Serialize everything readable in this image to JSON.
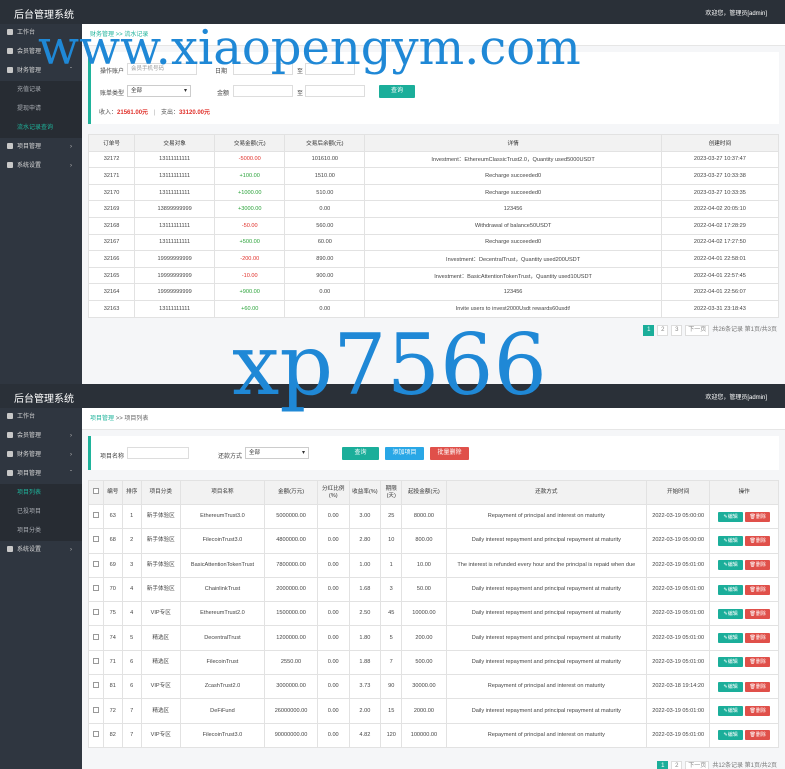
{
  "brand": "后台管理系统",
  "panel1": {
    "user": "欢迎您，管理员[admin]",
    "menu": [
      {
        "label": "工作台",
        "sub": []
      },
      {
        "label": "会员管理",
        "caret": "›",
        "sub": []
      },
      {
        "label": "财务管理",
        "caret": "ˇ",
        "sub": [
          "充值记录",
          "提现申请",
          "流水记录查询"
        ]
      },
      {
        "label": "项目管理",
        "caret": "›",
        "sub": []
      },
      {
        "label": "系统设置",
        "caret": "›",
        "sub": []
      }
    ],
    "crumb": "财务管理 >> 流水记录",
    "filter": {
      "account_label": "操作账户",
      "account_placeholder": "会员手机号码",
      "date_label": "日期",
      "date_to": "至",
      "type_label": "账单类型",
      "type_value": "全部",
      "amount_label": "金额",
      "amount_to": "至",
      "search_btn": "查询"
    },
    "summary": {
      "income_label": "收入：",
      "income": "21561.00元",
      "sep": "|",
      "expense_label": "支出：",
      "expense": "33120.00元"
    },
    "columns": [
      "订单号",
      "交易对象",
      "交易金额(元)",
      "交易后余额(元)",
      "详情",
      "创建时间"
    ],
    "rows": [
      [
        "32172",
        "13111111111",
        "-5000.00",
        "101610.00",
        "Investment：EthereumClassicTrust2.0，Quantity used5000USDT",
        "2023-03-27 10:37:47"
      ],
      [
        "32171",
        "13111111111",
        "+100.00",
        "1510.00",
        "Recharge succeeded0",
        "2023-03-27 10:33:38"
      ],
      [
        "32170",
        "13111111111",
        "+1000.00",
        "510.00",
        "Recharge succeeded0",
        "2023-03-27 10:33:35"
      ],
      [
        "32169",
        "13899999999",
        "+3000.00",
        "0.00",
        "123456",
        "2022-04-02 20:05:10"
      ],
      [
        "32168",
        "13111111111",
        "-50.00",
        "560.00",
        "Withdrawal of balance50USDT",
        "2022-04-02 17:28:29"
      ],
      [
        "32167",
        "13111111111",
        "+500.00",
        "60.00",
        "Recharge succeeded0",
        "2022-04-02 17:27:50"
      ],
      [
        "32166",
        "19999999999",
        "-200.00",
        "890.00",
        "Investment：DecentralTrust，Quantity used200USDT",
        "2022-04-01 22:58:01"
      ],
      [
        "32165",
        "19999999999",
        "-10.00",
        "900.00",
        "Investment：BasicAttentionTokenTrust，Quantity used10USDT",
        "2022-04-01 22:57:45"
      ],
      [
        "32164",
        "19999999999",
        "+900.00",
        "0.00",
        "123456",
        "2022-04-01 22:56:07"
      ],
      [
        "32163",
        "13111111111",
        "+60.00",
        "0.00",
        "Invite users to invest2000Usdt rewards60usdt!",
        "2022-03-31 23:18:43"
      ]
    ],
    "pager": {
      "pages": [
        "1",
        "2",
        "3"
      ],
      "next": "下一页",
      "info": "共26条记录 第1页/共3页"
    }
  },
  "panel2": {
    "user": "欢迎您，管理员[admin]",
    "menu": [
      {
        "label": "工作台",
        "sub": []
      },
      {
        "label": "会员管理",
        "caret": "›",
        "sub": []
      },
      {
        "label": "财务管理",
        "caret": "›",
        "sub": []
      },
      {
        "label": "项目管理",
        "caret": "ˇ",
        "sub": [
          "项目列表",
          "已投项目",
          "项目分类"
        ]
      },
      {
        "label": "系统设置",
        "caret": "›",
        "sub": []
      }
    ],
    "crumb_link": "项目管理",
    "crumb_rest": ">>  项目列表",
    "filter": {
      "name_label": "项目名称",
      "method_label": "还款方式",
      "method_value": "全部",
      "search_btn": "查询",
      "add_btn": "添加项目",
      "del_btn": "批量删除"
    },
    "columns": [
      "",
      "编号",
      "排序",
      "项目分类",
      "项目名称",
      "金额(万元)",
      "分红比例(%)",
      "收益率(%)",
      "期限(天)",
      "起投金额(元)",
      "还款方式",
      "开始时间",
      "操作"
    ],
    "edit_label": "编辑",
    "delete_label": "删除",
    "rows": [
      [
        "63",
        "1",
        "新手体验区",
        "EthereumTrust3.0",
        "5000000.00",
        "0.00",
        "3.00",
        "25",
        "8000.00",
        "Repayment of principal and interest on maturity",
        "2022-03-19 05:00:00"
      ],
      [
        "68",
        "2",
        "新手体验区",
        "FilecoinTrust3.0",
        "4800000.00",
        "0.00",
        "2.80",
        "10",
        "800.00",
        "Daily interest repayment and principal repayment at maturity",
        "2022-03-19 05:00:00"
      ],
      [
        "69",
        "3",
        "新手体验区",
        "BasicAttentionTokenTrust",
        "7800000.00",
        "0.00",
        "1.00",
        "1",
        "10.00",
        "The interest is refunded every hour and the principal is repaid when due",
        "2022-03-19 05:01:00"
      ],
      [
        "70",
        "4",
        "新手体验区",
        "ChainlinkTrust",
        "2000000.00",
        "0.00",
        "1.68",
        "3",
        "50.00",
        "Daily interest repayment and principal repayment at maturity",
        "2022-03-19 05:01:00"
      ],
      [
        "75",
        "4",
        "VIP专区",
        "EthereumTrust2.0",
        "1500000.00",
        "0.00",
        "2.50",
        "45",
        "10000.00",
        "Daily interest repayment and principal repayment at maturity",
        "2022-03-19 05:01:00"
      ],
      [
        "74",
        "5",
        "精选区",
        "DecentralTrust",
        "1200000.00",
        "0.00",
        "1.80",
        "5",
        "200.00",
        "Daily interest repayment and principal repayment at maturity",
        "2022-03-19 05:01:00"
      ],
      [
        "71",
        "6",
        "精选区",
        "FilecoinTrust",
        "2550.00",
        "0.00",
        "1.88",
        "7",
        "500.00",
        "Daily interest repayment and principal repayment at maturity",
        "2022-03-19 05:01:00"
      ],
      [
        "81",
        "6",
        "VIP专区",
        "ZcashTrust2.0",
        "3000000.00",
        "0.00",
        "3.73",
        "90",
        "30000.00",
        "Repayment of principal and interest on maturity",
        "2022-03-18 19:14:20"
      ],
      [
        "72",
        "7",
        "精选区",
        "DeFiFund",
        "26000000.00",
        "0.00",
        "2.00",
        "15",
        "2000.00",
        "Daily interest repayment and principal repayment at maturity",
        "2022-03-19 05:01:00"
      ],
      [
        "82",
        "7",
        "VIP专区",
        "FilecoinTrust3.0",
        "90000000.00",
        "0.00",
        "4.82",
        "120",
        "100000.00",
        "Repayment of principal and interest on maturity",
        "2022-03-19 05:01:00"
      ]
    ],
    "pager": {
      "pages": [
        "1",
        "2"
      ],
      "next": "下一页",
      "info": "共12条记录 第1页/共2页"
    }
  },
  "watermark1": "www.xiaopengym.com",
  "watermark2": "xp7566",
  "colors": {
    "accent": "#1bae9a",
    "negative": "#e0302a",
    "positive": "#2aa33a",
    "topbar": "#2a3038",
    "sidebar": "#2f3640"
  }
}
